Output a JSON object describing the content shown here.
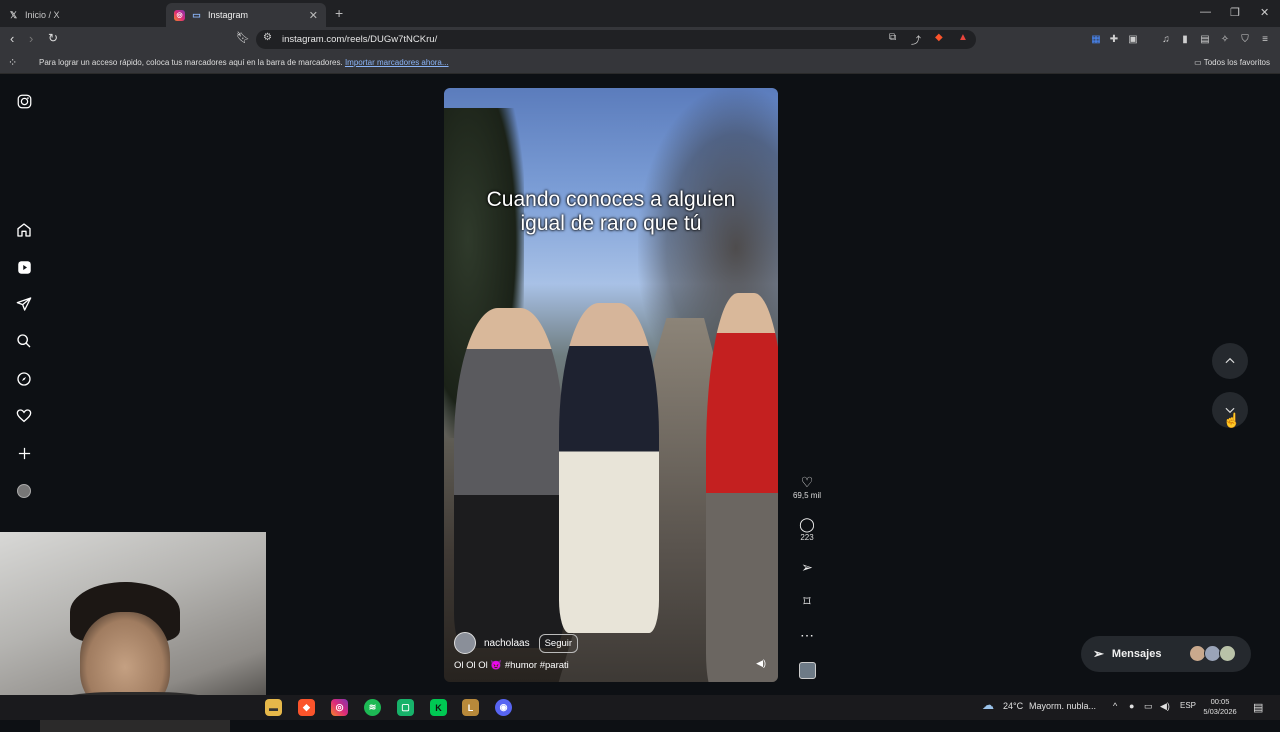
{
  "browser": {
    "tabs": [
      {
        "title": "Inicio / X",
        "favicon": "x-icon",
        "active": false
      },
      {
        "title": "Instagram",
        "favicon": "instagram-icon",
        "active": true
      }
    ],
    "url": "instagram.com/reels/DUGw7tNCKru/",
    "bookmarks_bar": {
      "message": "Para lograr un acceso rápido, coloca tus marcadores aquí en la barra de marcadores.",
      "import_link": "Importar marcadores ahora...",
      "all_favorites": "Todos los favoritos"
    }
  },
  "reel": {
    "caption_line1": "Cuando conoces a alguien",
    "caption_line2": "igual de raro que tú",
    "username": "nacholaas",
    "follow_label": "Seguir",
    "description": "Ol Ol Ol 😈 #humor #parati",
    "likes": "69,5 mil",
    "comments": "223"
  },
  "messages": {
    "label": "Mensajes"
  },
  "taskbar": {
    "weather_temp": "24°C",
    "weather_desc": "Mayorm. nubla...",
    "language": "ESP",
    "time": "00:05",
    "date": "5/03/2026"
  },
  "colors": {
    "page_bg": "#0d1014",
    "accent_link": "#8ab4f8",
    "brave": "#fb542b",
    "spotify": "#1db954"
  }
}
